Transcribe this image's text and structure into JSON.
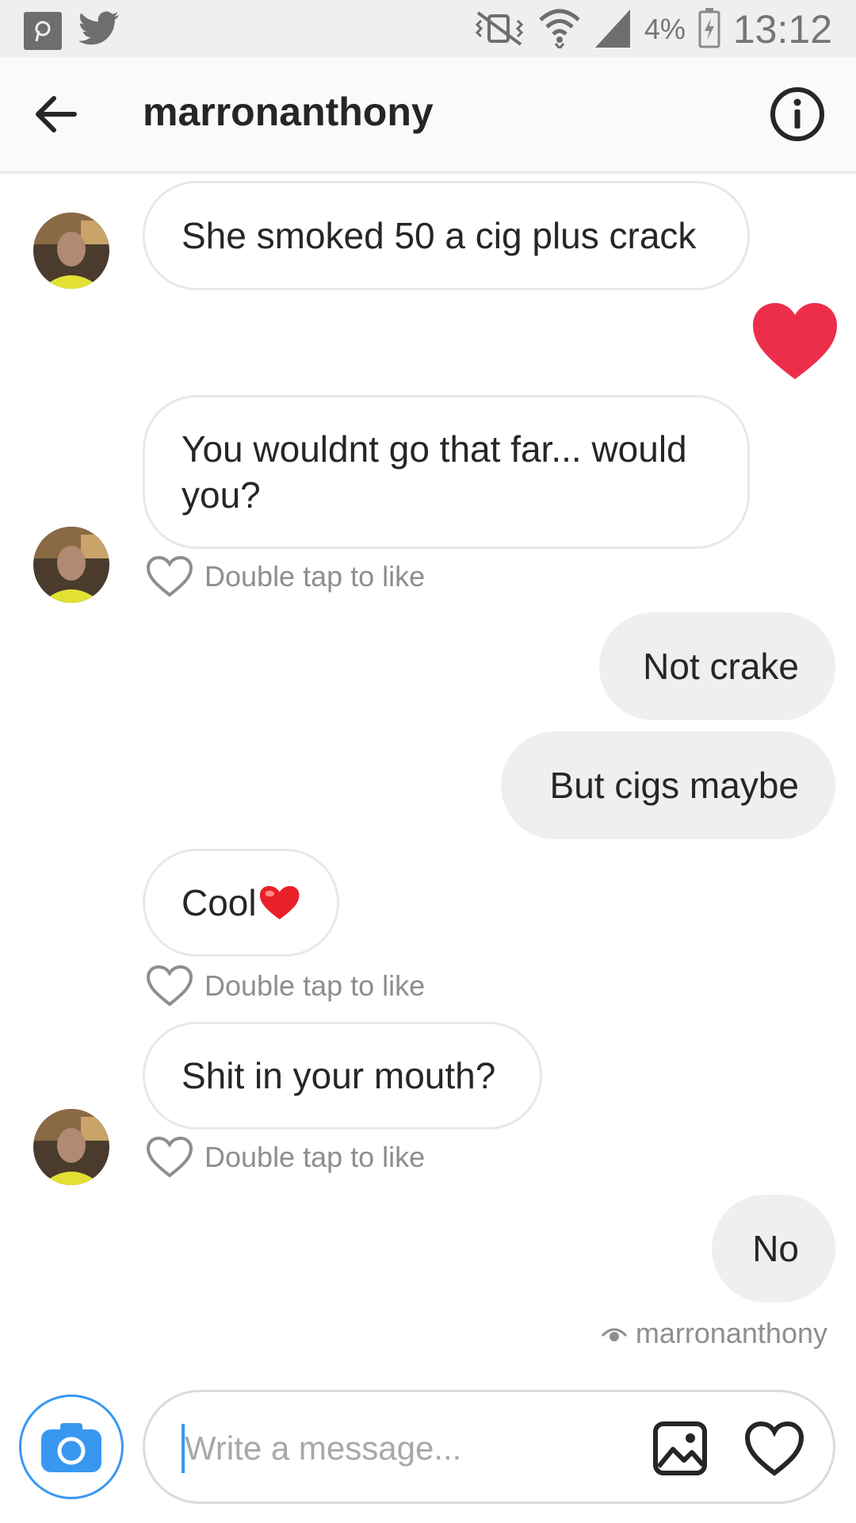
{
  "status_bar": {
    "icons_left": [
      "pinterest-like-icon",
      "twitter-icon"
    ],
    "icons_right": [
      "mute-vibrate-icon",
      "wifi-icon",
      "signal-icon",
      "battery-icon"
    ],
    "battery_percent": "4%",
    "time": "13:12"
  },
  "header": {
    "title": "marronanthony",
    "back_icon": "arrow-left-icon",
    "info_icon": "info-icon"
  },
  "messages": [
    {
      "side": "in",
      "text": "She smoked 50 a cig plus crack"
    },
    {
      "side": "reaction",
      "icon": "heart-filled-icon",
      "color": "#ed2e4b"
    },
    {
      "side": "in",
      "text": "You wouldnt go that far... would you?"
    },
    {
      "side": "out",
      "text": "Not crake"
    },
    {
      "side": "out",
      "text": "But cigs maybe"
    },
    {
      "side": "in",
      "text": "Cool",
      "emoji": "red-heart"
    },
    {
      "side": "in",
      "text": "Shit in your mouth?"
    },
    {
      "side": "out",
      "text": "No"
    }
  ],
  "like_hint": "Double tap to like",
  "seen_by": "marronanthony",
  "composer": {
    "placeholder": "Write a message...",
    "camera_icon": "camera-icon",
    "gallery_icon": "gallery-icon",
    "heart_icon": "heart-outline-icon"
  },
  "colors": {
    "accent_blue": "#3897f0",
    "heart_red": "#ed2e4b",
    "bubble_out_bg": "#efefef",
    "bubble_in_border": "#e8e8e8"
  }
}
